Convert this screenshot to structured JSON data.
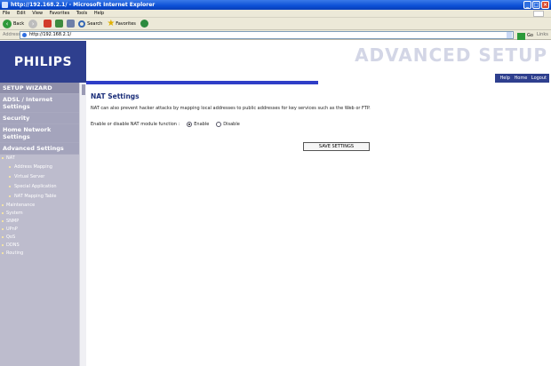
{
  "window": {
    "title": "http://192.168.2.1/ - Microsoft Internet Explorer",
    "min_label": "_",
    "max_label": "□",
    "close_label": "×"
  },
  "menu": [
    "File",
    "Edit",
    "View",
    "Favorites",
    "Tools",
    "Help"
  ],
  "toolbar": {
    "back_label": "Back",
    "search_label": "Search",
    "favorites_label": "Favorites"
  },
  "address": {
    "label": "Address",
    "value": "http://192.168.2.1/",
    "go_label": "Go",
    "links_label": "Links"
  },
  "brand": {
    "logo": "PHILIPS",
    "page_title": "ADVANCED SETUP",
    "header_links": [
      "Help",
      "Home",
      "Logout"
    ]
  },
  "sidebar": {
    "setup_wizard": "SETUP WIZARD",
    "adsl": "ADSL / Internet Settings",
    "security": "Security",
    "home_network": "Home Network Settings",
    "advanced": "Advanced Settings",
    "nat": "NAT",
    "nat_subs": [
      "Address Mapping",
      "Virtual Server",
      "Special Application",
      "NAT Mapping Table"
    ],
    "items": [
      "Maintenance",
      "System",
      "SNMP",
      "UPnP",
      "QoS",
      "DDNS",
      "Routing"
    ]
  },
  "content": {
    "heading": "NAT Settings",
    "description": "NAT can also prevent hacker attacks by mapping local addresses to public addresses for key services such as the Web or FTP.",
    "nat_label": "Enable or disable NAT module function :",
    "enable_label": "Enable",
    "disable_label": "Disable",
    "nat_enabled": true,
    "save_label": "SAVE SETTINGS"
  },
  "colors": {
    "logo_bg": "#2e3f8e",
    "sidebar_bg": "#bdbccd",
    "accent_bar": "#2f3ec7",
    "heading": "#1c2f7a"
  }
}
